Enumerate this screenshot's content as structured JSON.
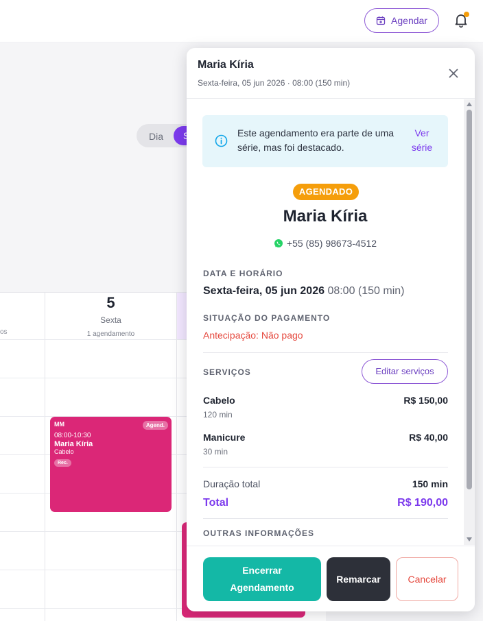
{
  "header": {
    "schedule_button_label": "Agendar",
    "icons": [
      "calendar-plus-icon",
      "bell-icon"
    ],
    "notification_dot_color": "#f59e0b"
  },
  "calendar": {
    "view_toggle": {
      "day_label": "Dia",
      "week_label_partial": "S"
    },
    "prev_column_count_fragment": "os",
    "day": {
      "number": "5",
      "weekday": "Sexta",
      "count": "1 agendamento"
    },
    "event": {
      "initials": "MM",
      "badge": "Agend.",
      "time": "08:00-10:30",
      "client": "Maria Kíria",
      "service": "Cabelo",
      "tag": "Rec.",
      "color": "#db2777"
    }
  },
  "panel": {
    "title": "Maria Kíria",
    "subtitle": "Sexta-feira, 05 jun 2026 · 08:00 (150 min)",
    "notice": {
      "text": "Este agendamento era parte de uma série, mas foi destacado.",
      "link_label": "Ver série"
    },
    "status_badge": "AGENDADO",
    "client_name": "Maria Kíria",
    "phone": "+55 (85) 98673-4512",
    "date_section": {
      "label": "DATA E HORÁRIO",
      "date": "Sexta-feira, 05 jun 2026",
      "time": "08:00 (150 min)"
    },
    "payment_section": {
      "label": "SITUAÇÃO DO PAGAMENTO",
      "status": "Antecipação: Não pago",
      "status_color": "#e5483d"
    },
    "services_section": {
      "label": "SERVIÇOS",
      "edit_button": "Editar serviços",
      "items": [
        {
          "name": "Cabelo",
          "duration": "120 min",
          "price": "R$ 150,00"
        },
        {
          "name": "Manicure",
          "duration": "30 min",
          "price": "R$ 40,00"
        }
      ],
      "total_duration_label": "Duração total",
      "total_duration_value": "150 min",
      "total_label": "Total",
      "total_value": "R$ 190,00"
    },
    "other_info_label": "OUTRAS INFORMAÇÕES",
    "footer": {
      "end_button": "Encerrar Agendamento",
      "reschedule_button": "Remarcar",
      "cancel_button": "Cancelar"
    },
    "accent_color": "#7c3aed",
    "status_color": "#f59e0b",
    "end_button_color": "#14b8a6"
  }
}
